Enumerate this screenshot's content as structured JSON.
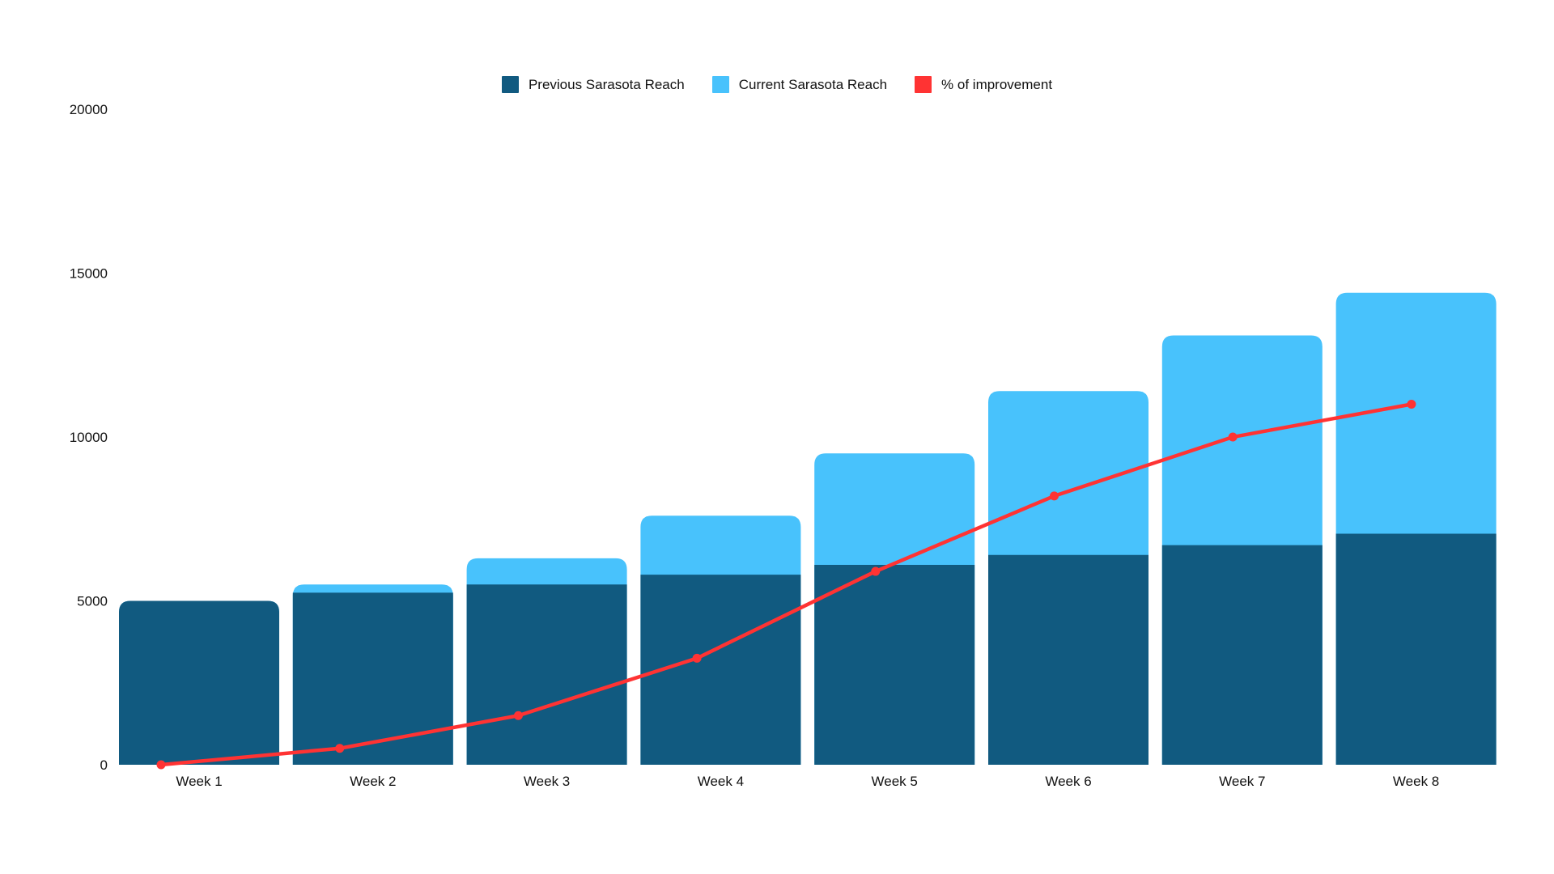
{
  "chart_data": {
    "type": "bar",
    "title": "",
    "xlabel": "",
    "ylabel": "",
    "ylim": [
      0,
      20000
    ],
    "y_ticks": [
      "0",
      "5000",
      "10000",
      "15000",
      "20000"
    ],
    "y_tick_values": [
      0,
      5000,
      10000,
      15000,
      20000
    ],
    "grid": false,
    "legend_position": "top-center",
    "categories": [
      "Week 1",
      "Week 2",
      "Week 3",
      "Week 4",
      "Week 5",
      "Week 6",
      "Week 7",
      "Week 8"
    ],
    "series": [
      {
        "name": "Previous Sarasota Reach",
        "type": "bar",
        "color": "#115a80",
        "values": [
          5000,
          5250,
          5500,
          5800,
          6100,
          6400,
          6700,
          7050
        ]
      },
      {
        "name": "Current Sarasota Reach",
        "type": "bar",
        "color": "#48c2fc",
        "values": [
          5000,
          5500,
          6300,
          7600,
          9500,
          11400,
          13100,
          14400
        ]
      },
      {
        "name": "% of improvement",
        "type": "line",
        "color": "#ff3333",
        "values": [
          0,
          500,
          1500,
          3250,
          5900,
          8200,
          10000,
          11000
        ]
      }
    ]
  },
  "legend": [
    {
      "label": "Previous Sarasota Reach",
      "color": "#115a80"
    },
    {
      "label": "Current Sarasota Reach",
      "color": "#48c2fc"
    },
    {
      "label": "% of improvement",
      "color": "#ff3333"
    }
  ]
}
